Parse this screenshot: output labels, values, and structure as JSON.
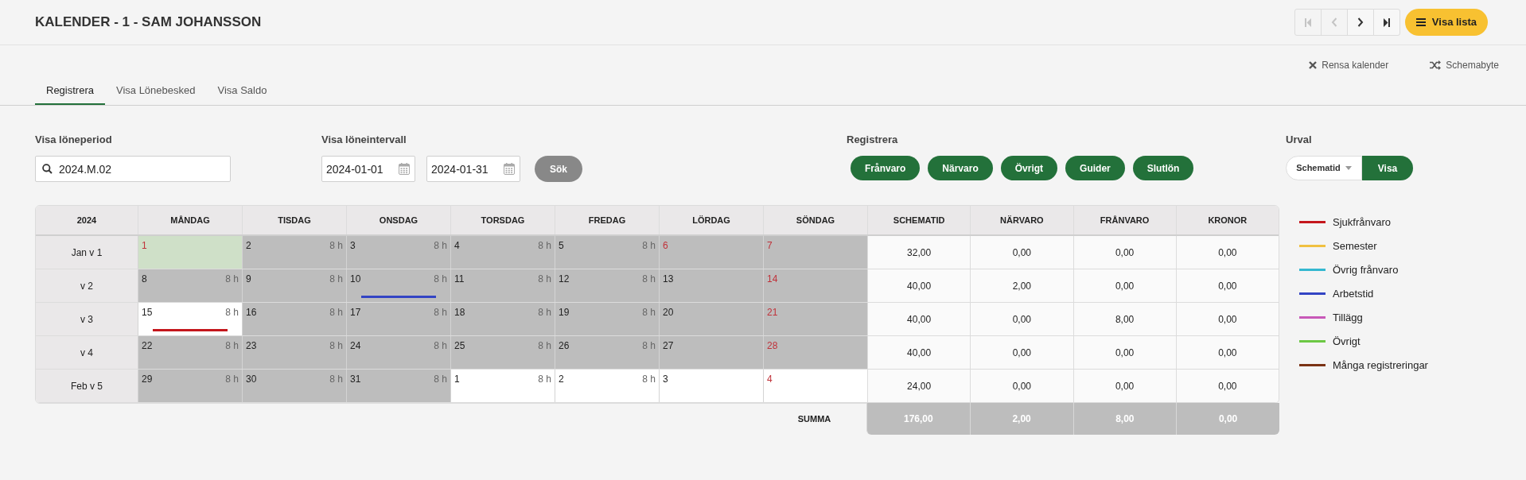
{
  "title": "KALENDER - 1 - SAM JOHANSSON",
  "pager": [
    {
      "kind": "first",
      "disabled": true
    },
    {
      "kind": "prev",
      "disabled": true
    },
    {
      "kind": "next",
      "disabled": false
    },
    {
      "kind": "last",
      "disabled": false
    }
  ],
  "list_button": "Visa lista",
  "actions": [
    {
      "kind": "clear",
      "label": "Rensa kalender"
    },
    {
      "kind": "swap",
      "label": "Schemabyte"
    }
  ],
  "tabs": [
    {
      "label": "Registrera",
      "selected": true
    },
    {
      "label": "Visa Lönebesked",
      "selected": false
    },
    {
      "label": "Visa Saldo",
      "selected": false
    }
  ],
  "period": {
    "label": "Visa löneperiod",
    "value": "2024.M.02"
  },
  "interval": {
    "label": "Visa löneintervall",
    "from": "2024-01-01",
    "to": "2024-01-31",
    "button": "Sök"
  },
  "register": {
    "label": "Registrera",
    "buttons": [
      "Frånvaro",
      "Närvaro",
      "Övrigt",
      "Guider",
      "Slutlön"
    ]
  },
  "urval": {
    "label": "Urval",
    "select": "Schematid",
    "button": "Visa"
  },
  "table": {
    "columns": [
      "2024",
      "MÅNDAG",
      "TISDAG",
      "ONSDAG",
      "TORSDAG",
      "FREDAG",
      "LÖRDAG",
      "SÖNDAG",
      "SCHEMATID",
      "NÄRVARO",
      "FRÅNVARO",
      "KRONOR"
    ],
    "rows": [
      {
        "cells": [
          {
            "kind": "week",
            "text": "Jan v 1"
          },
          {
            "kind": "current",
            "day": "1",
            "red_day": true
          },
          {
            "kind": "scheduled",
            "day": "2",
            "hours": "8 h",
            "red_day": false
          },
          {
            "kind": "scheduled",
            "day": "3",
            "hours": "8 h",
            "red_day": false
          },
          {
            "kind": "scheduled",
            "day": "4",
            "hours": "8 h",
            "red_day": false
          },
          {
            "kind": "scheduled",
            "day": "5",
            "hours": "8 h",
            "red_day": false
          },
          {
            "kind": "scheduled",
            "day": "6",
            "red_day": true
          },
          {
            "kind": "scheduled",
            "day": "7",
            "red_day": true
          },
          {
            "kind": "total",
            "text": "32,00"
          },
          {
            "kind": "total",
            "text": "0,00"
          },
          {
            "kind": "total",
            "text": "0,00"
          },
          {
            "kind": "total",
            "text": "0,00"
          }
        ]
      },
      {
        "cells": [
          {
            "kind": "week",
            "text": "v 2"
          },
          {
            "kind": "scheduled",
            "day": "8",
            "hours": "8 h",
            "red_day": false
          },
          {
            "kind": "scheduled",
            "day": "9",
            "hours": "8 h",
            "red_day": false
          },
          {
            "kind": "scheduled",
            "day": "10",
            "hours": "8 h",
            "red_day": false,
            "color": "#3344c4"
          },
          {
            "kind": "scheduled",
            "day": "11",
            "hours": "8 h",
            "red_day": false
          },
          {
            "kind": "scheduled",
            "day": "12",
            "hours": "8 h",
            "red_day": false
          },
          {
            "kind": "scheduled",
            "day": "13",
            "red_day": false
          },
          {
            "kind": "scheduled",
            "day": "14",
            "red_day": true
          },
          {
            "kind": "total",
            "text": "40,00"
          },
          {
            "kind": "total",
            "text": "2,00"
          },
          {
            "kind": "total",
            "text": "0,00"
          },
          {
            "kind": "total",
            "text": "0,00"
          }
        ]
      },
      {
        "cells": [
          {
            "kind": "week",
            "text": "v 3"
          },
          {
            "kind": "open",
            "day": "15",
            "hours": "8 h",
            "red_day": false,
            "color": "#c4161c"
          },
          {
            "kind": "scheduled",
            "day": "16",
            "hours": "8 h",
            "red_day": false
          },
          {
            "kind": "scheduled",
            "day": "17",
            "hours": "8 h",
            "red_day": false
          },
          {
            "kind": "scheduled",
            "day": "18",
            "hours": "8 h",
            "red_day": false
          },
          {
            "kind": "scheduled",
            "day": "19",
            "hours": "8 h",
            "red_day": false
          },
          {
            "kind": "scheduled",
            "day": "20",
            "red_day": false
          },
          {
            "kind": "scheduled",
            "day": "21",
            "red_day": true
          },
          {
            "kind": "total",
            "text": "40,00"
          },
          {
            "kind": "total",
            "text": "0,00"
          },
          {
            "kind": "total",
            "text": "8,00"
          },
          {
            "kind": "total",
            "text": "0,00"
          }
        ]
      },
      {
        "cells": [
          {
            "kind": "week",
            "text": "v 4"
          },
          {
            "kind": "scheduled",
            "day": "22",
            "hours": "8 h",
            "red_day": false
          },
          {
            "kind": "scheduled",
            "day": "23",
            "hours": "8 h",
            "red_day": false
          },
          {
            "kind": "scheduled",
            "day": "24",
            "hours": "8 h",
            "red_day": false
          },
          {
            "kind": "scheduled",
            "day": "25",
            "hours": "8 h",
            "red_day": false
          },
          {
            "kind": "scheduled",
            "day": "26",
            "hours": "8 h",
            "red_day": false
          },
          {
            "kind": "scheduled",
            "day": "27",
            "red_day": false
          },
          {
            "kind": "scheduled",
            "day": "28",
            "red_day": true
          },
          {
            "kind": "total",
            "text": "40,00"
          },
          {
            "kind": "total",
            "text": "0,00"
          },
          {
            "kind": "total",
            "text": "0,00"
          },
          {
            "kind": "total",
            "text": "0,00"
          }
        ]
      },
      {
        "cells": [
          {
            "kind": "week",
            "text": "Feb v 5"
          },
          {
            "kind": "scheduled",
            "day": "29",
            "hours": "8 h",
            "red_day": false
          },
          {
            "kind": "scheduled",
            "day": "30",
            "hours": "8 h",
            "red_day": false
          },
          {
            "kind": "scheduled",
            "day": "31",
            "hours": "8 h",
            "red_day": false
          },
          {
            "kind": "open",
            "day": "1",
            "hours": "8 h",
            "red_day": false
          },
          {
            "kind": "open",
            "day": "2",
            "hours": "8 h",
            "red_day": false
          },
          {
            "kind": "open",
            "day": "3",
            "red_day": false
          },
          {
            "kind": "open",
            "day": "4",
            "red_day": true
          },
          {
            "kind": "total",
            "text": "24,00"
          },
          {
            "kind": "total",
            "text": "0,00"
          },
          {
            "kind": "total",
            "text": "0,00"
          },
          {
            "kind": "total",
            "text": "0,00"
          }
        ]
      }
    ],
    "sum_label": "SUMMA",
    "sums": [
      "176,00",
      "2,00",
      "8,00",
      "0,00"
    ]
  },
  "legend": [
    {
      "label": "Sjukfrånvaro",
      "color": "#c4161c"
    },
    {
      "label": "Semester",
      "color": "#f0c040"
    },
    {
      "label": "Övrig frånvaro",
      "color": "#34b8d0"
    },
    {
      "label": "Arbetstid",
      "color": "#3344c4"
    },
    {
      "label": "Tillägg",
      "color": "#c858b8"
    },
    {
      "label": "Övrigt",
      "color": "#6cc844"
    },
    {
      "label": "Många registreringar",
      "color": "#7a3214"
    }
  ]
}
